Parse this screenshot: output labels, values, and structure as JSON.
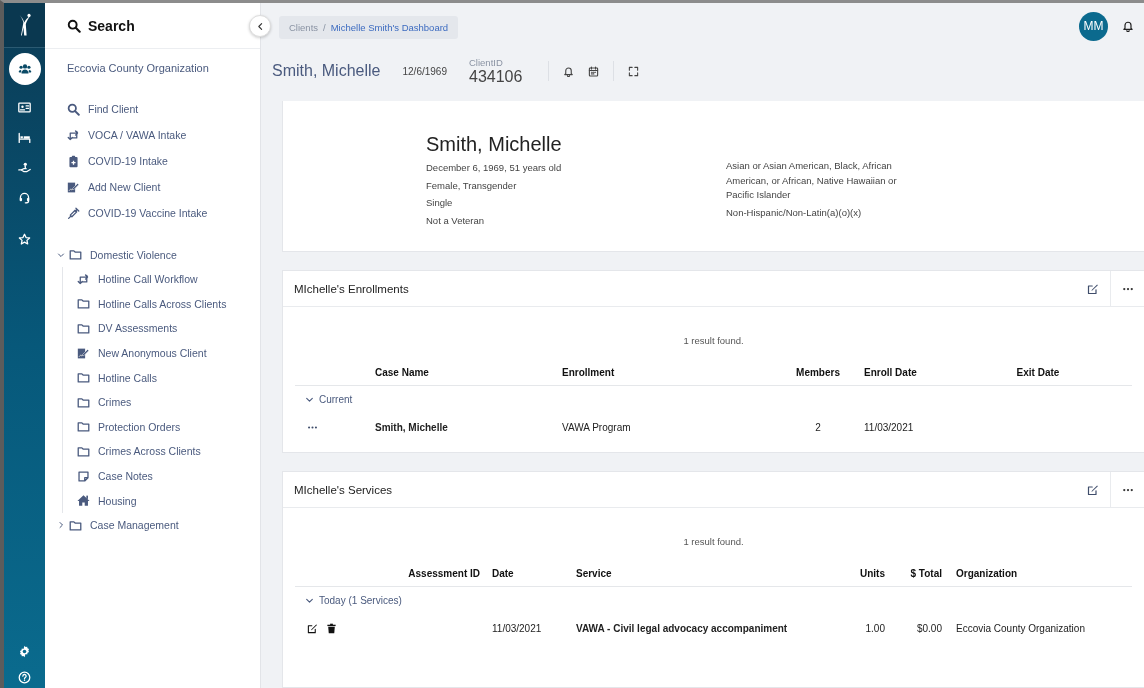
{
  "rail": {
    "items": [
      {
        "kind": "people",
        "selected": true
      },
      {
        "kind": "id-card",
        "selected": false
      },
      {
        "kind": "bed",
        "selected": false
      },
      {
        "kind": "hand",
        "selected": false
      },
      {
        "kind": "headset",
        "selected": false
      },
      {
        "kind": "star",
        "selected": false
      }
    ],
    "bottom_items": [
      {
        "kind": "gear"
      },
      {
        "kind": "help"
      }
    ]
  },
  "nav": {
    "title": "Search",
    "organization": "Eccovia County Organization",
    "actions": [
      {
        "label": "Find Client",
        "kind": "search"
      },
      {
        "label": "VOCA / VAWA Intake",
        "kind": "workflow"
      },
      {
        "label": "COVID-19 Intake",
        "kind": "clipboard"
      },
      {
        "label": "Add New Client",
        "kind": "signature"
      },
      {
        "label": "COVID-19 Vaccine Intake",
        "kind": "syringe"
      }
    ],
    "tree": [
      {
        "label": "Domestic Violence",
        "expanded": true,
        "children": [
          {
            "label": "Hotline Call Workflow",
            "kind": "workflow"
          },
          {
            "label": "Hotline Calls Across Clients",
            "kind": "folder"
          },
          {
            "label": "DV Assessments",
            "kind": "folder"
          },
          {
            "label": "New Anonymous Client",
            "kind": "signature"
          },
          {
            "label": "Hotline Calls",
            "kind": "folder"
          },
          {
            "label": "Crimes",
            "kind": "folder"
          },
          {
            "label": "Protection Orders",
            "kind": "folder"
          },
          {
            "label": "Crimes Across Clients",
            "kind": "folder"
          },
          {
            "label": "Case Notes",
            "kind": "note"
          },
          {
            "label": "Housing",
            "kind": "house"
          }
        ]
      },
      {
        "label": "Case Management",
        "expanded": false
      }
    ]
  },
  "breadcrumb_separator": "/",
  "breadcrumb": [
    {
      "label": "Clients",
      "selected": false
    },
    {
      "label": "Michelle Smith's Dashboard",
      "selected": true
    }
  ],
  "user": {
    "initials": "MM"
  },
  "client_header": {
    "name": "Smith, Michelle",
    "dob": "12/6/1969",
    "client_id_label": "ClientID",
    "client_id": "434106"
  },
  "profile": {
    "name": "Smith, Michelle",
    "details_left": [
      "December 6, 1969, 51 years old",
      "Female, Transgender",
      "Single",
      "Not a Veteran"
    ],
    "details_right": [
      "Asian or Asian American, Black, African American, or African, Native Hawaiian or Pacific Islander",
      "Non-Hispanic/Non-Latin(a)(o)(x)"
    ]
  },
  "enrollments": {
    "title": "MIchelle's Enrollments",
    "result_text": "1 result found.",
    "columns": [
      "Case Name",
      "Enrollment",
      "Members",
      "Enroll Date",
      "Exit Date"
    ],
    "groups": [
      {
        "label": "Current",
        "expanded": true,
        "rows": [
          [
            "Smith, Michelle",
            "VAWA Program",
            "2",
            "11/03/2021",
            ""
          ]
        ]
      }
    ]
  },
  "services": {
    "title": "MIchelle's Services",
    "result_text": "1 result found.",
    "columns": [
      "Assessment ID",
      "Date",
      "Service",
      "Units",
      "$ Total",
      "Organization"
    ],
    "groups": [
      {
        "label": "Today (1 Services)",
        "expanded": true,
        "rows": [
          [
            "",
            "11/03/2021",
            "VAWA - Civil legal advocacy accompaniment",
            "1.00",
            "$0.00",
            "Eccovia County Organization"
          ]
        ]
      }
    ]
  }
}
